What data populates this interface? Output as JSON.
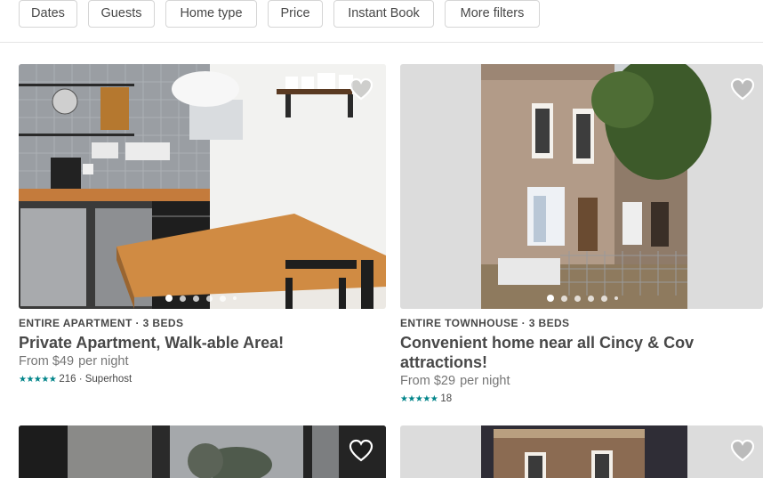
{
  "filters": [
    "Dates",
    "Guests",
    "Home type",
    "Price",
    "Instant Book",
    "More filters"
  ],
  "listings": [
    {
      "kicker": "ENTIRE APARTMENT · 3 BEDS",
      "title": "Private Apartment, Walk-able Area!",
      "price": "From $49",
      "per": "per night",
      "stars": "★★★★★",
      "reviews": "216",
      "superhost": "· Superhost"
    },
    {
      "kicker": "ENTIRE TOWNHOUSE · 3 BEDS",
      "title": "Convenient home near all Cincy & Cov attractions!",
      "price": "From $29",
      "per": "per night",
      "stars": "★★★★★",
      "reviews": "18"
    }
  ],
  "icons": {
    "heart": "heart-outline-icon",
    "star": "star-icon"
  },
  "colors": {
    "accent": "#008489",
    "text": "#484848",
    "muted": "#767676",
    "border": "#d5d5d5"
  }
}
